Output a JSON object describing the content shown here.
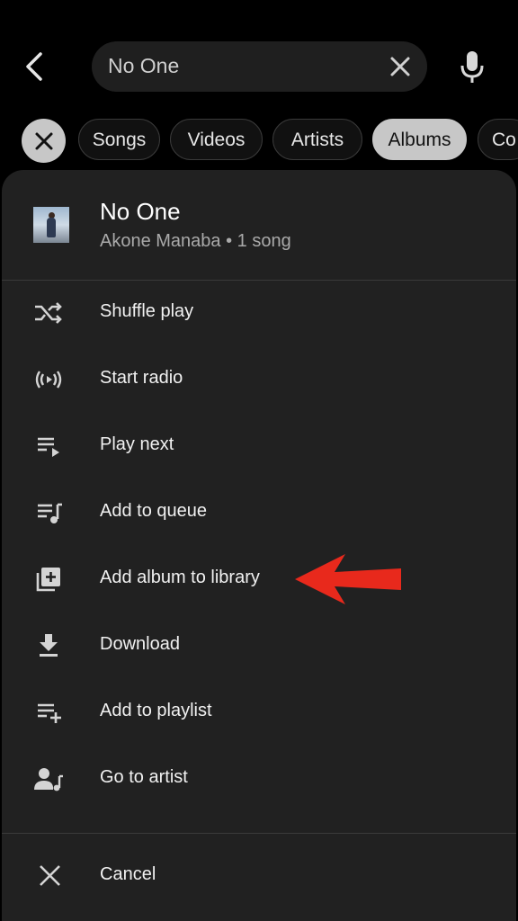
{
  "search": {
    "query": "No One"
  },
  "chips": [
    {
      "label": "Songs",
      "selected": false
    },
    {
      "label": "Videos",
      "selected": false
    },
    {
      "label": "Artists",
      "selected": false
    },
    {
      "label": "Albums",
      "selected": true
    },
    {
      "label": "Co",
      "selected": false
    }
  ],
  "sheet": {
    "album_title": "No One",
    "album_sub": "Akone Manaba • 1 song",
    "items": [
      {
        "label": "Shuffle play",
        "icon": "shuffle-icon"
      },
      {
        "label": "Start radio",
        "icon": "radio-icon"
      },
      {
        "label": "Play next",
        "icon": "play-next-icon"
      },
      {
        "label": "Add to queue",
        "icon": "queue-icon"
      },
      {
        "label": "Add album to library",
        "icon": "library-add-icon"
      },
      {
        "label": "Download",
        "icon": "download-icon"
      },
      {
        "label": "Add to playlist",
        "icon": "playlist-add-icon"
      },
      {
        "label": "Go to artist",
        "icon": "artist-icon"
      }
    ],
    "cancel_label": "Cancel"
  },
  "colors": {
    "annotation_arrow": "#e8291c",
    "sheet_bg": "#212121"
  }
}
